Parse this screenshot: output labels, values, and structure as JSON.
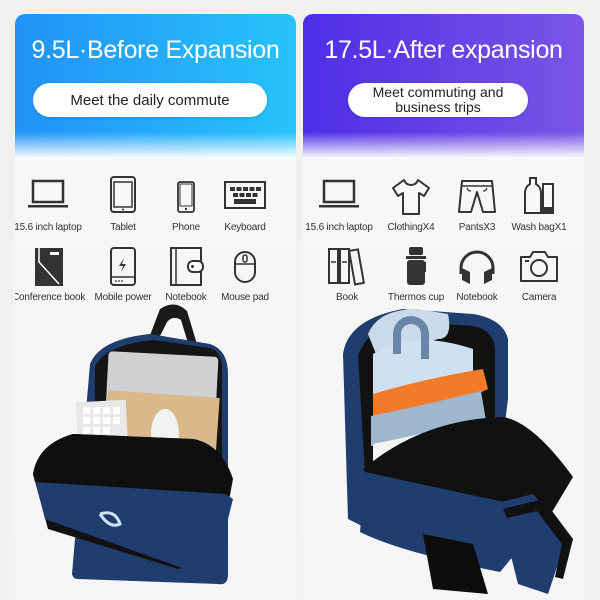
{
  "before": {
    "title": "9.5L·Before Expansion",
    "subtitle": "Meet the daily commute",
    "accent_start": "#2292f6",
    "accent_end": "#27c3fc",
    "items": [
      {
        "label": "15.6 inch laptop",
        "icon": "laptop-icon"
      },
      {
        "label": "Tablet",
        "icon": "tablet-icon"
      },
      {
        "label": "Phone",
        "icon": "phone-icon"
      },
      {
        "label": "Keyboard",
        "icon": "keyboard-icon"
      },
      {
        "label": "Conference book",
        "icon": "conference-book-icon"
      },
      {
        "label": "Mobile power",
        "icon": "power-bank-icon"
      },
      {
        "label": "Notebook",
        "icon": "notebook-icon"
      },
      {
        "label": "Mouse pad",
        "icon": "mouse-icon"
      }
    ],
    "photo": "backpack-before-expansion-image"
  },
  "after": {
    "title": "17.5L·After expansion",
    "subtitle": "Meet commuting and\nbusiness trips",
    "accent_start": "#4e2ee7",
    "accent_end": "#7a55e6",
    "items": [
      {
        "label": "15.6 inch laptop",
        "icon": "laptop-icon"
      },
      {
        "label": "ClothingX4",
        "icon": "tshirt-icon"
      },
      {
        "label": "PantsX3",
        "icon": "pants-icon"
      },
      {
        "label": "Wash bagX1",
        "icon": "toiletries-icon"
      },
      {
        "label": "Book",
        "icon": "books-icon"
      },
      {
        "label": "Thermos cup",
        "icon": "thermos-icon"
      },
      {
        "label": "Notebook",
        "icon": "headphones-icon"
      },
      {
        "label": "Camera",
        "icon": "camera-icon"
      }
    ],
    "photo": "backpack-after-expansion-image"
  }
}
